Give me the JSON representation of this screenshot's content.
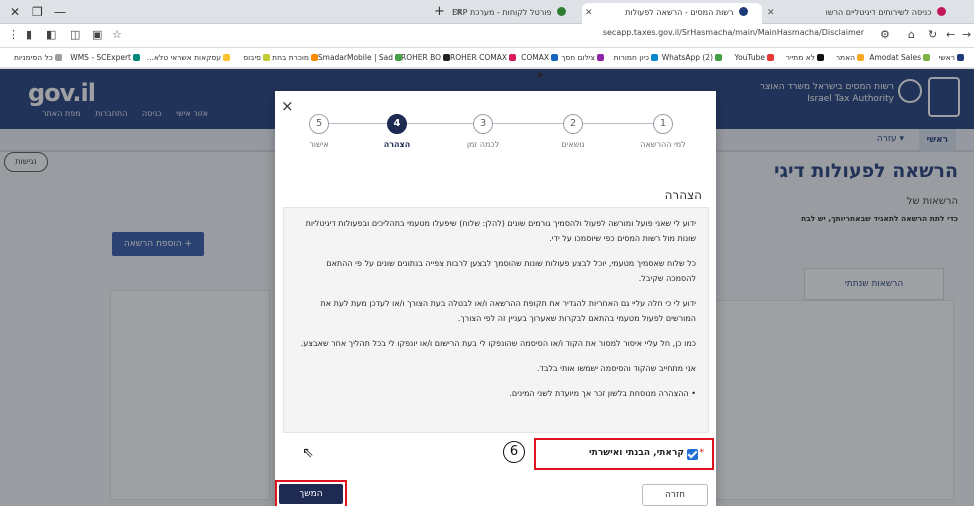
{
  "browser": {
    "tabs": [
      {
        "label": "כניסה לשירותים דיגיטליים הרשו",
        "icon_color": "#c2185b"
      },
      {
        "label": "רשות המסים - הרשאה לפעולות",
        "icon_color": "#1e3a78"
      },
      {
        "label": "פורטל לקוחות - מערכת ERP ©",
        "icon_color": "#2e7d32"
      }
    ],
    "new_tab": "+",
    "url": "secapp.taxes.gov.il/SrHasmacha/main/MainHasmacha/Disclaimer",
    "bookmarks": [
      "ראשי",
      "Amodat Sales",
      "האתר",
      "לא מתייר",
      "YouTube",
      "(2) WhatsApp",
      "כיון חמורות",
      "צילום חסך",
      "COMAX",
      "ROHER COMAX",
      "ROHER BO",
      "SmadarMobile | Sad...",
      "מוכרת בחת",
      "סיבוס",
      "עסקאות אשראי טלא...",
      "WMS - SCExpert",
      "כל הסימניות"
    ]
  },
  "site": {
    "logo": "gov.il",
    "top_links": [
      "אזור אישי",
      "כניסה",
      "התחברות",
      "מפת האתר"
    ],
    "authority": "רשות המסים בישראל משרד האוצר",
    "authority_en": "Israel Tax Authority",
    "nav_home": "ראשי",
    "nav_help": "עזרה ▾",
    "accessibility": "נגישות",
    "page_title": "הרשאה לפעולות דיגי",
    "subtitle": "הרשאות של",
    "subtitle_note": "כדי לתת הרשאה לתאגיד שבאחריותך, יש לבח",
    "add_permission": "+ הוספת הרשאה",
    "permissions_tab": "הרשאות שנתתי"
  },
  "modal": {
    "close": "×",
    "steps": [
      {
        "num": "1",
        "label": "למי ההרשאה",
        "active": false
      },
      {
        "num": "2",
        "label": "נושאים",
        "active": false
      },
      {
        "num": "3",
        "label": "לכמה זמן",
        "active": false
      },
      {
        "num": "4",
        "label": "הצהרה",
        "active": true
      },
      {
        "num": "5",
        "label": "אישור",
        "active": false
      }
    ],
    "section_title": "הצהרה",
    "declaration_paragraphs": [
      "ידוע לי שאני פועל ומורשה לפעול ולהסמיך גורמים שונים (להלן: שלוח) שיפעלו מטעמי בתהליכים ובפעולות דיגיטליות שונות מול רשות המסים כפי שיוסמכו על ידי.",
      "כל שלוח שאסמיך מטעמי, יוכל לבצע פעולות שונות שהוסמך לבצען לרבות צפייה בנתונים שונים על פי ההתאם להסמכה שקיבל.",
      "ידוע לי כי חלה עליי גם האחריות להגדיר את תקופת ההרשאה ו/או לבטלה בעת הצורך ו/או לעדכן מעת לעת את המורשים לפעול מטעמי בהתאם לבקרות שאערוך בעניין זה לפי הצורך.",
      "כמו כן, חל עליי איסור למסור את הקוד ו/או הסיסמה שהונפקו לי בעת הרישום ו/או יונפקו לי בכל תהליך אחר שאבצע.",
      "אני מתחייב שהקוד והסיסמה ישמשו אותי בלבד.",
      "• ההצהרה מנוסחת בלשון זכר אך מיועדת לשני המינים."
    ],
    "confirm_label": "קראתי, הבנתי ואישרתי",
    "required_mark": "*",
    "callout_number": "6",
    "continue_button": "המשך",
    "back_button": "חזרה"
  },
  "colors": {
    "header_blue": "#1e3a78",
    "accent_navy": "#1e2a52",
    "highlight_red": "#e0141e",
    "checkbox_blue": "#1f6fd6"
  }
}
